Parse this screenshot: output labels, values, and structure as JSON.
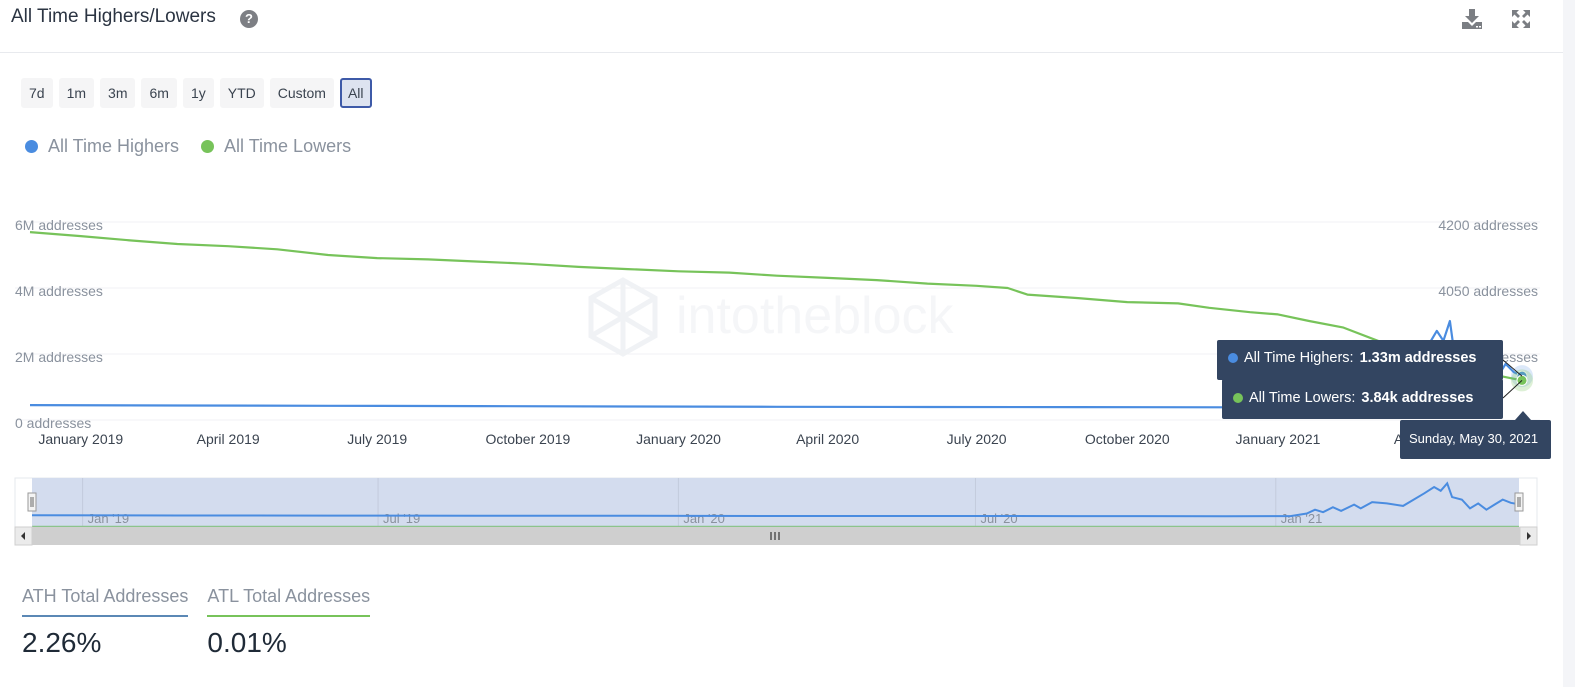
{
  "header": {
    "title": "All Time Highers/Lowers",
    "help_icon": "question-circle-icon",
    "download_icon": "download-icon",
    "expand_icon": "expand-arrows-icon"
  },
  "ranges": [
    "7d",
    "1m",
    "3m",
    "6m",
    "1y",
    "YTD",
    "Custom",
    "All"
  ],
  "active_range": "All",
  "colors": {
    "highers": "#4a8ce0",
    "lowers": "#77c35a",
    "tooltip_bg": "#334561",
    "navigator_fill": "#d3dcee"
  },
  "watermark": "intotheblock",
  "tooltip": {
    "highers_label": "All Time Highers:",
    "highers_value": "1.33m addresses",
    "lowers_label": "All Time Lowers:",
    "lowers_value": "3.84k addresses",
    "date": "Sunday, May 30, 2021"
  },
  "navigator": {
    "labels": [
      "Jan '19",
      "Jul '19",
      "Jan '20",
      "Jul '20",
      "Jan '21"
    ]
  },
  "stats": [
    {
      "label": "ATH Total Addresses",
      "value": "2.26%"
    },
    {
      "label": "ATL Total Addresses",
      "value": "0.01%"
    }
  ],
  "chart_data": {
    "type": "line",
    "title": "All Time Highers/Lowers",
    "x_range": [
      "2018-12-01",
      "2021-05-30"
    ],
    "x_ticks": [
      "January 2019",
      "April 2019",
      "July 2019",
      "October 2019",
      "January 2020",
      "April 2020",
      "July 2020",
      "October 2020",
      "January 2021",
      "April 2021"
    ],
    "y_left": {
      "label": "",
      "unit": "addresses",
      "range": [
        0,
        6000000
      ],
      "ticks": [
        "0 addresses",
        "2M addresses",
        "4M addresses",
        "6M addresses"
      ],
      "tick_values": [
        0,
        2000000,
        4000000,
        6000000
      ]
    },
    "y_right": {
      "label": "",
      "unit": "addresses",
      "range": [
        3750,
        4200
      ],
      "ticks": [
        "3900 addresses",
        "4050 addresses",
        "4200 addresses"
      ],
      "tick_values": [
        3900,
        4050,
        4200
      ]
    },
    "grid": true,
    "legend": "top-left",
    "series": [
      {
        "name": "All Time Highers",
        "axis": "left",
        "points": [
          [
            "2018-12-01",
            450000
          ],
          [
            "2019-03-01",
            440000
          ],
          [
            "2019-06-01",
            430000
          ],
          [
            "2019-09-01",
            420000
          ],
          [
            "2019-12-01",
            410000
          ],
          [
            "2020-03-01",
            400000
          ],
          [
            "2020-06-01",
            395000
          ],
          [
            "2020-09-01",
            390000
          ],
          [
            "2020-12-01",
            385000
          ],
          [
            "2021-01-10",
            390000
          ],
          [
            "2021-01-20",
            600000
          ],
          [
            "2021-01-25",
            900000
          ],
          [
            "2021-01-30",
            700000
          ],
          [
            "2021-02-05",
            1100000
          ],
          [
            "2021-02-10",
            800000
          ],
          [
            "2021-02-18",
            1300000
          ],
          [
            "2021-02-22",
            1000000
          ],
          [
            "2021-03-01",
            1500000
          ],
          [
            "2021-03-10",
            1400000
          ],
          [
            "2021-03-20",
            1200000
          ],
          [
            "2021-04-02",
            2200000
          ],
          [
            "2021-04-08",
            2700000
          ],
          [
            "2021-04-12",
            2400000
          ],
          [
            "2021-04-16",
            3000000
          ],
          [
            "2021-04-19",
            1900000
          ],
          [
            "2021-04-25",
            1700000
          ],
          [
            "2021-04-30",
            1000000
          ],
          [
            "2021-05-05",
            1400000
          ],
          [
            "2021-05-10",
            900000
          ],
          [
            "2021-05-15",
            1300000
          ],
          [
            "2021-05-20",
            1700000
          ],
          [
            "2021-05-25",
            1450000
          ],
          [
            "2021-05-30",
            1330000
          ]
        ]
      },
      {
        "name": "All Time Lowers",
        "axis": "right",
        "points": [
          [
            "2018-12-01",
            4177
          ],
          [
            "2019-01-01",
            4168
          ],
          [
            "2019-02-01",
            4158
          ],
          [
            "2019-03-01",
            4150
          ],
          [
            "2019-04-01",
            4145
          ],
          [
            "2019-05-01",
            4138
          ],
          [
            "2019-06-01",
            4125
          ],
          [
            "2019-07-01",
            4118
          ],
          [
            "2019-08-01",
            4115
          ],
          [
            "2019-09-01",
            4110
          ],
          [
            "2019-10-01",
            4105
          ],
          [
            "2019-11-01",
            4098
          ],
          [
            "2019-12-01",
            4093
          ],
          [
            "2020-01-01",
            4088
          ],
          [
            "2020-02-01",
            4085
          ],
          [
            "2020-03-01",
            4078
          ],
          [
            "2020-04-01",
            4073
          ],
          [
            "2020-05-01",
            4068
          ],
          [
            "2020-06-01",
            4060
          ],
          [
            "2020-07-01",
            4055
          ],
          [
            "2020-07-20",
            4050
          ],
          [
            "2020-08-01",
            4035
          ],
          [
            "2020-09-01",
            4027
          ],
          [
            "2020-10-01",
            4018
          ],
          [
            "2020-11-01",
            4015
          ],
          [
            "2020-11-20",
            4005
          ],
          [
            "2020-12-15",
            3995
          ],
          [
            "2021-01-01",
            3990
          ],
          [
            "2021-01-20",
            3975
          ],
          [
            "2021-02-10",
            3960
          ],
          [
            "2021-03-10",
            3920
          ],
          [
            "2021-04-10",
            3880
          ],
          [
            "2021-05-10",
            3855
          ],
          [
            "2021-05-30",
            3840
          ]
        ]
      }
    ],
    "tooltip": {
      "date": "Sunday, May 30, 2021",
      "All Time Highers": 1330000,
      "All Time Lowers": 3840
    }
  }
}
